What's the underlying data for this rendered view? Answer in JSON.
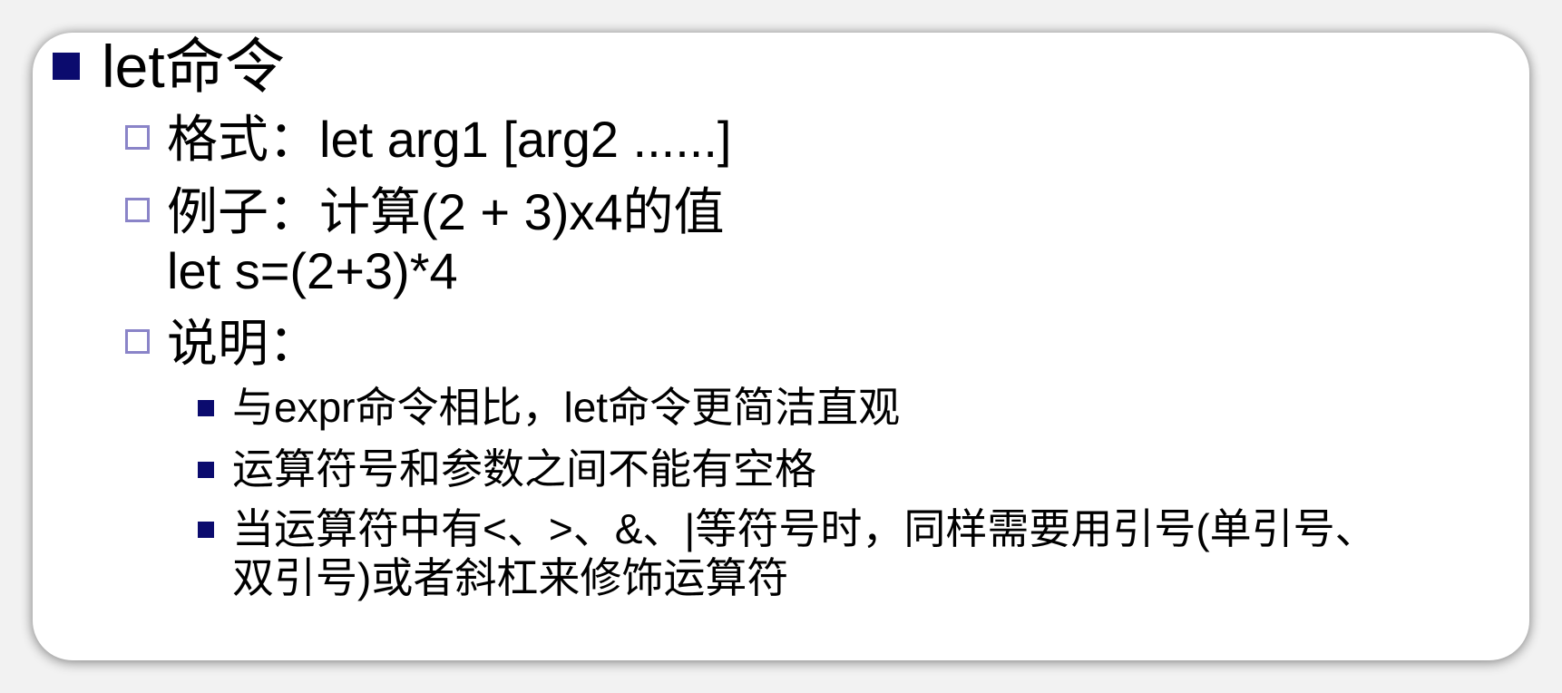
{
  "slide": {
    "heading": "let命令",
    "format": "格式：let arg1 [arg2 ......]",
    "example_line1": "例子：计算(2 + 3)x4的值",
    "example_line2": "let s=(2+3)*4",
    "note": "说明：",
    "details": [
      "与expr命令相比，let命令更简洁直观",
      "运算符号和参数之间不能有空格",
      "当运算符中有<、>、&、|等符号时，同样需要用引号(单引号、",
      "双引号)或者斜杠来修饰运算符"
    ]
  },
  "colors": {
    "bullet_filled": "#0b0b6e",
    "bullet_hollow_border": "#8a84c8",
    "background": "#f2f2f2",
    "card": "#ffffff"
  }
}
